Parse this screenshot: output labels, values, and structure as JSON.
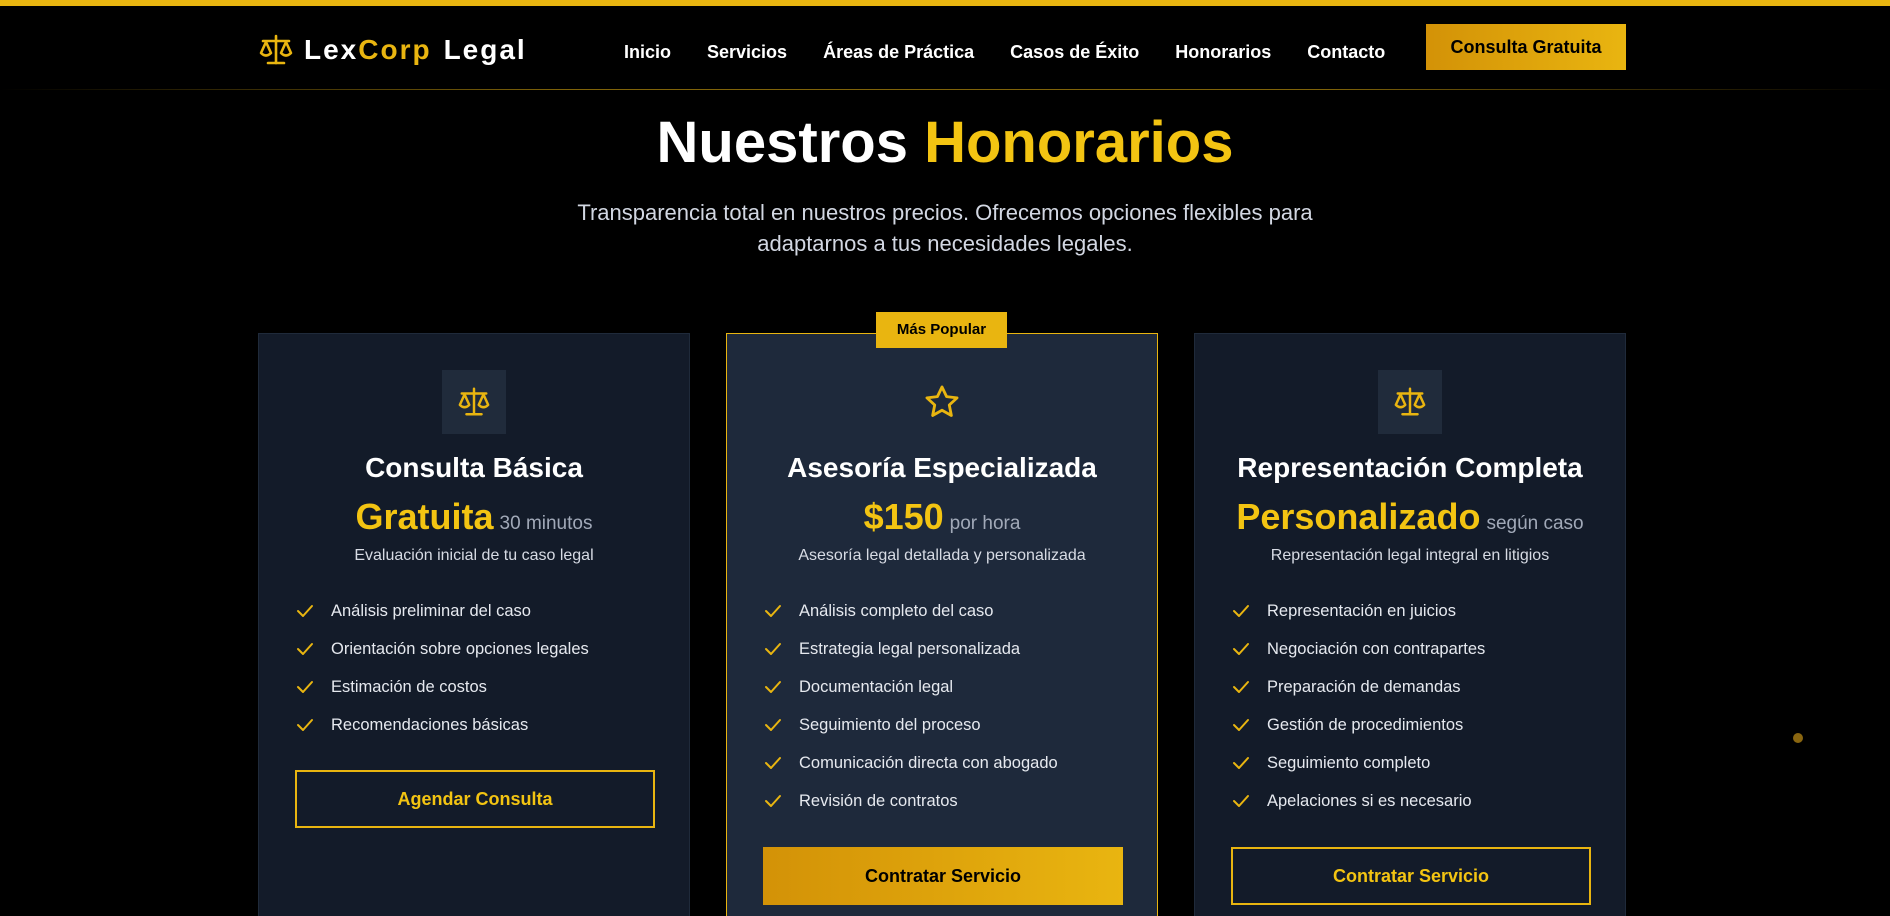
{
  "header": {
    "brand": {
      "part1": "Lex",
      "part2": "Corp",
      "part3": "Legal",
      "icon": "scale-icon"
    },
    "nav": [
      "Inicio",
      "Servicios",
      "Áreas de Práctica",
      "Casos de Éxito",
      "Honorarios",
      "Contacto"
    ],
    "cta": "Consulta Gratuita"
  },
  "hero": {
    "title_part1": "Nuestros",
    "title_part2": "Honorarios",
    "subtitle": "Transparencia total en nuestros precios. Ofrecemos opciones flexibles para adaptarnos a tus necesidades legales."
  },
  "plans": [
    {
      "name": "Consulta Básica",
      "price": "Gratuita",
      "period": "30 minutos",
      "description": "Evaluación inicial de tu caso legal",
      "icon": "scale-icon",
      "features": [
        "Análisis preliminar del caso",
        "Orientación sobre opciones legales",
        "Estimación de costos",
        "Recomendaciones básicas"
      ],
      "button": "Agendar Consulta"
    },
    {
      "badge": "Más Popular",
      "name": "Asesoría Especializada",
      "price": "$150",
      "period": "por hora",
      "description": "Asesoría legal detallada y personalizada",
      "icon": "star-icon",
      "features": [
        "Análisis completo del caso",
        "Estrategia legal personalizada",
        "Documentación legal",
        "Seguimiento del proceso",
        "Comunicación directa con abogado",
        "Revisión de contratos"
      ],
      "button": "Contratar Servicio"
    },
    {
      "name": "Representación Completa",
      "price": "Personalizado",
      "period": "según caso",
      "description": "Representación legal integral en litigios",
      "icon": "scale-icon",
      "features": [
        "Representación en juicios",
        "Negociación con contrapartes",
        "Preparación de demandas",
        "Gestión de procedimientos",
        "Seguimiento completo",
        "Apelaciones si es necesario"
      ],
      "button": "Contratar Servicio"
    }
  ],
  "colors": {
    "accent": "#e9b510",
    "accent_dark": "#d39207",
    "background": "#000000",
    "card": "#131b29",
    "card_featured": "#1e293b"
  }
}
